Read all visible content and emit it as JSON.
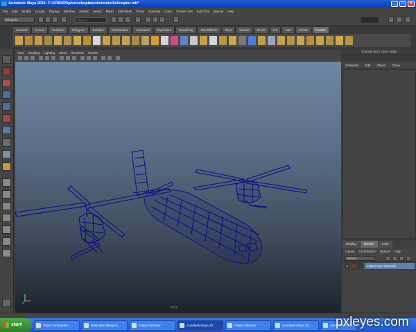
{
  "window": {
    "title": "Autodesk Maya 2011: F:\\JOBURI\\photoshoptalent\\vintokril\\elicopter.mb*"
  },
  "menubar": {
    "items": [
      "File",
      "Edit",
      "Modify",
      "Create",
      "Display",
      "Window",
      "Assets",
      "Select",
      "Mesh",
      "Edit Mesh",
      "Proxy",
      "Normals",
      "Color",
      "Create UVs",
      "Edit UVs",
      "Muscle",
      "Help"
    ]
  },
  "statusline": {
    "mode": "Polygons",
    "field_placeholder": "Objects"
  },
  "shelf": {
    "tabs": [
      "General",
      "Curves",
      "Surfaces",
      "Polygons",
      "Subdivs",
      "Deformation",
      "Animation",
      "Dynamics",
      "Rendering",
      "PaintEffects",
      "Toon",
      "Muscle",
      "Fluids",
      "Fur",
      "Hair",
      "nCloth",
      "Custom"
    ],
    "active_tab": "Custom"
  },
  "panel": {
    "menu": [
      "View",
      "Shading",
      "Lighting",
      "Show",
      "Renderer",
      "Panels"
    ],
    "camera_label": "persp"
  },
  "channel_box": {
    "title": "Channel Box / Layer Editor",
    "menu": [
      "Channels",
      "Edit",
      "Object",
      "Show"
    ]
  },
  "layer_editor": {
    "tabs": [
      "Display",
      "Render",
      "Anim"
    ],
    "active_tab": "Render",
    "menu": [
      "Layers",
      "Contribution",
      "Options",
      "Help"
    ],
    "mode": "Normal",
    "layer_name": "masterLayer (Normal)",
    "vis_mark": "R"
  },
  "taskbar": {
    "start_label": "start",
    "tasks": [
      {
        "label": "Total Commander ..."
      },
      {
        "label": "Helicopter Blueprin..."
      },
      {
        "label": "Output Window"
      },
      {
        "label": "Autodesk Maya 20..."
      },
      {
        "label": "Output Window"
      },
      {
        "label": "Autodesk Maya 20..."
      },
      {
        "label": "Adobe Photosh..."
      }
    ]
  },
  "watermark": "pxleyes.com",
  "colors": {
    "wire": "#0b0d86",
    "viewport_top": "#6f86a3",
    "viewport_bottom": "#1d232b",
    "taskbar": "#2b63d8",
    "layer_highlight": "#5d81a8"
  }
}
